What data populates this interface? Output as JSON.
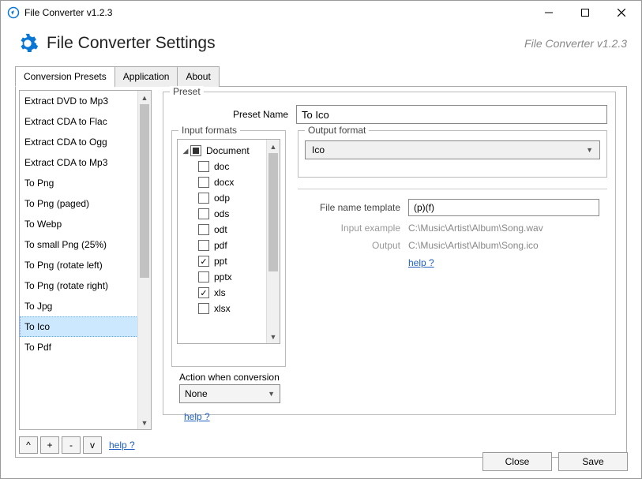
{
  "window": {
    "title": "File Converter v1.2.3",
    "subtitle": "File Converter v1.2.3"
  },
  "header": {
    "title": "File Converter Settings"
  },
  "tabs": {
    "presets": "Conversion Presets",
    "application": "Application",
    "about": "About"
  },
  "presets_list": {
    "items": [
      "Extract DVD to Mp3",
      "Extract CDA to Flac",
      "Extract CDA to Ogg",
      "Extract CDA to Mp3",
      "To Png",
      "To Png (paged)",
      "To Webp",
      "To small Png (25%)",
      "To Png (rotate left)",
      "To Png (rotate right)",
      "To Jpg",
      "To Ico",
      "To Pdf"
    ],
    "selected_index": 11
  },
  "preset_panel": {
    "legend": "Preset",
    "name_label": "Preset Name",
    "name_value": "To Ico"
  },
  "input_formats": {
    "legend": "Input formats",
    "root": "Document",
    "children": [
      {
        "label": "doc",
        "checked": false
      },
      {
        "label": "docx",
        "checked": false
      },
      {
        "label": "odp",
        "checked": false
      },
      {
        "label": "ods",
        "checked": false
      },
      {
        "label": "odt",
        "checked": false
      },
      {
        "label": "pdf",
        "checked": false
      },
      {
        "label": "ppt",
        "checked": true
      },
      {
        "label": "pptx",
        "checked": false
      },
      {
        "label": "xls",
        "checked": true
      },
      {
        "label": "xlsx",
        "checked": false
      }
    ],
    "action_label": "Action when conversion",
    "action_value": "None",
    "help": "help ?"
  },
  "output_format": {
    "legend": "Output format",
    "value": "Ico"
  },
  "template": {
    "label": "File name template",
    "value": "(p)(f)",
    "example_label": "Input example",
    "example_value": "C:\\Music\\Artist\\Album\\Song.wav",
    "output_label": "Output",
    "output_value": "C:\\Music\\Artist\\Album\\Song.ico",
    "help": "help ?"
  },
  "left_footer": {
    "up": "^",
    "add": "+",
    "remove": "-",
    "down": "v",
    "help": "help ?"
  },
  "bottom": {
    "close": "Close",
    "save": "Save"
  }
}
